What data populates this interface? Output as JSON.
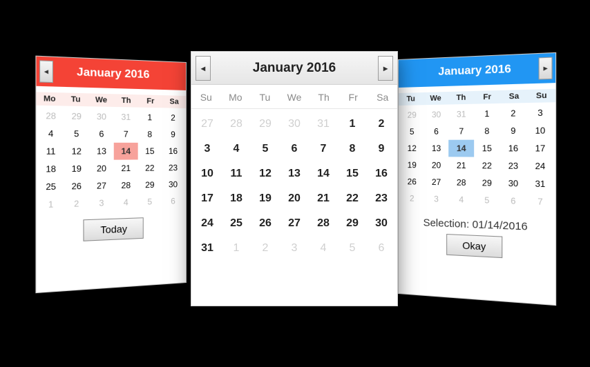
{
  "left": {
    "title": "January 2016",
    "dow": [
      "Mo",
      "Tu",
      "We",
      "Th",
      "Fr",
      "Sa"
    ],
    "days": [
      {
        "d": "28",
        "m": true
      },
      {
        "d": "29",
        "m": true
      },
      {
        "d": "30",
        "m": true
      },
      {
        "d": "31",
        "m": true
      },
      {
        "d": "1"
      },
      {
        "d": "2"
      },
      {
        "d": "4"
      },
      {
        "d": "5"
      },
      {
        "d": "6"
      },
      {
        "d": "7"
      },
      {
        "d": "8"
      },
      {
        "d": "9"
      },
      {
        "d": "11"
      },
      {
        "d": "12"
      },
      {
        "d": "13"
      },
      {
        "d": "14",
        "sel": true
      },
      {
        "d": "15"
      },
      {
        "d": "16"
      },
      {
        "d": "18"
      },
      {
        "d": "19"
      },
      {
        "d": "20"
      },
      {
        "d": "21"
      },
      {
        "d": "22"
      },
      {
        "d": "23"
      },
      {
        "d": "25"
      },
      {
        "d": "26"
      },
      {
        "d": "27"
      },
      {
        "d": "28"
      },
      {
        "d": "29"
      },
      {
        "d": "30"
      },
      {
        "d": "1",
        "m": true
      },
      {
        "d": "2",
        "m": true
      },
      {
        "d": "3",
        "m": true
      },
      {
        "d": "4",
        "m": true
      },
      {
        "d": "5",
        "m": true
      },
      {
        "d": "6",
        "m": true
      }
    ],
    "today_label": "Today"
  },
  "center": {
    "title": "January 2016",
    "dow": [
      "Su",
      "Mo",
      "Tu",
      "We",
      "Th",
      "Fr",
      "Sa"
    ],
    "days": [
      {
        "d": "27",
        "m": true
      },
      {
        "d": "28",
        "m": true
      },
      {
        "d": "29",
        "m": true
      },
      {
        "d": "30",
        "m": true
      },
      {
        "d": "31",
        "m": true
      },
      {
        "d": "1"
      },
      {
        "d": "2"
      },
      {
        "d": "3"
      },
      {
        "d": "4"
      },
      {
        "d": "5"
      },
      {
        "d": "6"
      },
      {
        "d": "7"
      },
      {
        "d": "8"
      },
      {
        "d": "9"
      },
      {
        "d": "10"
      },
      {
        "d": "11"
      },
      {
        "d": "12"
      },
      {
        "d": "13"
      },
      {
        "d": "14"
      },
      {
        "d": "15"
      },
      {
        "d": "16"
      },
      {
        "d": "17"
      },
      {
        "d": "18"
      },
      {
        "d": "19"
      },
      {
        "d": "20"
      },
      {
        "d": "21"
      },
      {
        "d": "22"
      },
      {
        "d": "23"
      },
      {
        "d": "24"
      },
      {
        "d": "25"
      },
      {
        "d": "26"
      },
      {
        "d": "27"
      },
      {
        "d": "28"
      },
      {
        "d": "29"
      },
      {
        "d": "30"
      },
      {
        "d": "31"
      },
      {
        "d": "1",
        "m": true
      },
      {
        "d": "2",
        "m": true
      },
      {
        "d": "3",
        "m": true
      },
      {
        "d": "4",
        "m": true
      },
      {
        "d": "5",
        "m": true
      },
      {
        "d": "6",
        "m": true
      }
    ]
  },
  "right": {
    "title": "January 2016",
    "dow": [
      "Tu",
      "We",
      "Th",
      "Fr",
      "Sa",
      "Su"
    ],
    "days": [
      {
        "d": "29",
        "m": true
      },
      {
        "d": "30",
        "m": true
      },
      {
        "d": "31",
        "m": true
      },
      {
        "d": "1"
      },
      {
        "d": "2"
      },
      {
        "d": "3"
      },
      {
        "d": "5"
      },
      {
        "d": "6"
      },
      {
        "d": "7"
      },
      {
        "d": "8"
      },
      {
        "d": "9"
      },
      {
        "d": "10"
      },
      {
        "d": "12"
      },
      {
        "d": "13"
      },
      {
        "d": "14",
        "sel": true
      },
      {
        "d": "15"
      },
      {
        "d": "16"
      },
      {
        "d": "17"
      },
      {
        "d": "19"
      },
      {
        "d": "20"
      },
      {
        "d": "21"
      },
      {
        "d": "22"
      },
      {
        "d": "23"
      },
      {
        "d": "24"
      },
      {
        "d": "26"
      },
      {
        "d": "27"
      },
      {
        "d": "28"
      },
      {
        "d": "29"
      },
      {
        "d": "30"
      },
      {
        "d": "31"
      },
      {
        "d": "2",
        "m": true
      },
      {
        "d": "3",
        "m": true
      },
      {
        "d": "4",
        "m": true
      },
      {
        "d": "5",
        "m": true
      },
      {
        "d": "6",
        "m": true
      },
      {
        "d": "7",
        "m": true
      }
    ],
    "selection_label": "Selection: 01/14/2016",
    "okay_label": "Okay"
  },
  "arrows": {
    "left": "◂",
    "right": "▸"
  }
}
